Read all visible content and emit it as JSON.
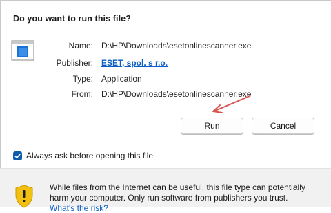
{
  "dialog": {
    "title": "Do you want to run this file?",
    "icon": "application-window-icon"
  },
  "details": [
    {
      "label": "Name:",
      "value": "D:\\HP\\Downloads\\esetonlinescanner.exe"
    },
    {
      "label": "Publisher:",
      "value": "ESET, spol. s r.o."
    },
    {
      "label": "Type:",
      "value": "Application"
    },
    {
      "label": "From:",
      "value": "D:\\HP\\Downloads\\esetonlinescanner.exe"
    }
  ],
  "buttons": {
    "run_label": "Run",
    "cancel_label": "Cancel"
  },
  "checkbox": {
    "label": "Always ask before opening this file",
    "checked": true
  },
  "warning": {
    "text": "While files from the Internet can be useful, this file type can potentially harm your computer. Only run software from publishers you trust.",
    "link_label": "What's the risk?",
    "icon": "shield-warning-icon"
  },
  "colors": {
    "link": "#0a5ec5",
    "checkbox": "#0b5cad",
    "annotation_arrow": "#d9534f",
    "shield_yellow": "#f2c010"
  }
}
